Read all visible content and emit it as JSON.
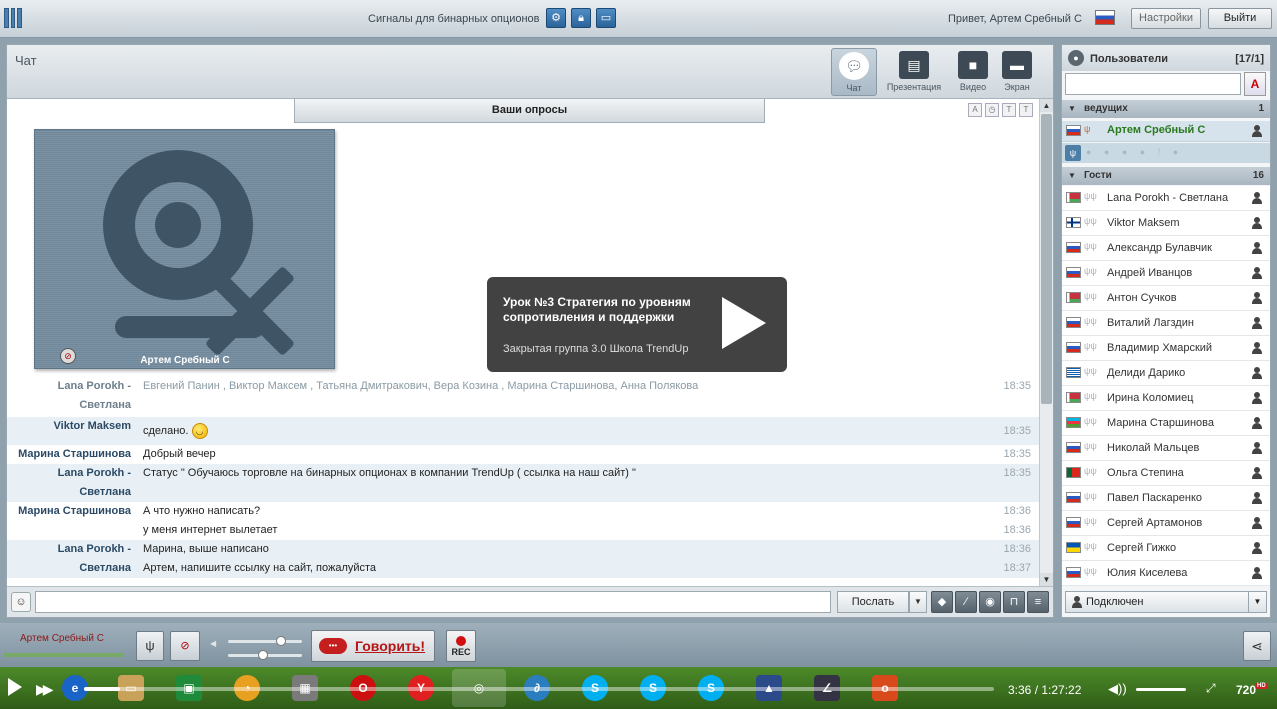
{
  "app": {
    "room_title": "Сигналы для бинарных опционов",
    "greeting": "Привет, Артем Сребный С",
    "settings_label": "Настройки",
    "logout_label": "Выйти",
    "top_icons": [
      "gear-icon",
      "lock-icon",
      "window-icon"
    ]
  },
  "chat": {
    "title": "Чат",
    "modes": [
      {
        "label": "Чат",
        "icon": "chat-bubble-icon",
        "active": true
      },
      {
        "label": "Презентация",
        "icon": "presentation-icon",
        "active": false
      },
      {
        "label": "Видео",
        "icon": "video-camera-icon",
        "active": false
      },
      {
        "label": "Экран",
        "icon": "monitor-icon",
        "active": false
      }
    ],
    "polls_tab": "Ваши опросы",
    "camera_owner": "Артем Сребный С",
    "messages": [
      {
        "author": "Lana Porokh - Светлана",
        "text": "Евгений Панин , Виктор Максем , Татьяна Дмитракович,  Вера Козина , Марина Старшинова, Анна Полякова",
        "time": "18:35",
        "system": true
      },
      {
        "author": "Viktor Maksem",
        "text": "сделано.",
        "time": "18:35",
        "smiley": true
      },
      {
        "author": "Марина Старшинова",
        "text": "Добрый вечер",
        "time": "18:35"
      },
      {
        "author": "Lana Porokh - Светлана",
        "text": "Статус \" Обучаюсь торговле на бинарных опционах в компании TrendUp ( ссылка на наш сайт) \"",
        "time": "18:35"
      },
      {
        "author": "Марина Старшинова",
        "text": "А что нужно написать?",
        "time": "18:36"
      },
      {
        "author": "",
        "text": "у меня интернет вылетает",
        "time": "18:36"
      },
      {
        "author": "Lana Porokh - Светлана",
        "text": "Марина, выше написано",
        "time": "18:36"
      },
      {
        "author": "",
        "text": "Артем, напишите ссылку на сайт, пожалуйста",
        "time": "18:37"
      }
    ],
    "send_label": "Послать",
    "input_value": "",
    "input_tools": [
      "eraser-icon",
      "link-icon",
      "eye-icon",
      "lock-icon",
      "list-icon"
    ]
  },
  "overlay": {
    "title": "Урок №3 Стратегия по уровням сопротивления и поддержки",
    "subtitle": "Закрытая группа 3.0 Школа TrendUp"
  },
  "users": {
    "title": "Пользователи",
    "count": "[17/1]",
    "search_value": "",
    "sort_label": "A",
    "groups": [
      {
        "name": "ведущих",
        "count": "1"
      },
      {
        "name": "Гости",
        "count": "16"
      }
    ],
    "host": {
      "name": "Артем Сребный С",
      "flag": "ru"
    },
    "guests": [
      {
        "name": "Lana Porokh - Светлана",
        "flag": "by"
      },
      {
        "name": "Viktor Maksem",
        "flag": "fi"
      },
      {
        "name": "Александр Булавчик",
        "flag": "ru"
      },
      {
        "name": "Андрей Иванцов",
        "flag": "ru"
      },
      {
        "name": "Антон Сучков",
        "flag": "by"
      },
      {
        "name": "Виталий Лагздин",
        "flag": "ru"
      },
      {
        "name": "Владимир Хмарский",
        "flag": "ru"
      },
      {
        "name": "Делиди Дарико",
        "flag": "gr"
      },
      {
        "name": "Ирина Коломиец",
        "flag": "by"
      },
      {
        "name": "Марина Старшинова",
        "flag": "az"
      },
      {
        "name": "Николай Мальцев",
        "flag": "ru"
      },
      {
        "name": "Ольга Степина",
        "flag": "pt"
      },
      {
        "name": "Павел Паскаренко",
        "flag": "ru"
      },
      {
        "name": "Сергей Артамонов",
        "flag": "ru"
      },
      {
        "name": "Сергей Гижко",
        "flag": "ua"
      },
      {
        "name": "Юлия Киселева",
        "flag": "ru"
      }
    ],
    "status": "Подключен"
  },
  "controls": {
    "user_name": "Артем Сребный С",
    "speak_label": "Говорить!",
    "rec_label": "REC"
  },
  "player": {
    "time": "3:36 / 1:27:22",
    "quality": "720",
    "quality_badge": "HD",
    "progress": 0.04
  },
  "colors": {
    "accent": "#2b6399",
    "host_name": "#2a7a1e",
    "speak_red": "#b51717",
    "taskbar": "#3a6e1f"
  }
}
